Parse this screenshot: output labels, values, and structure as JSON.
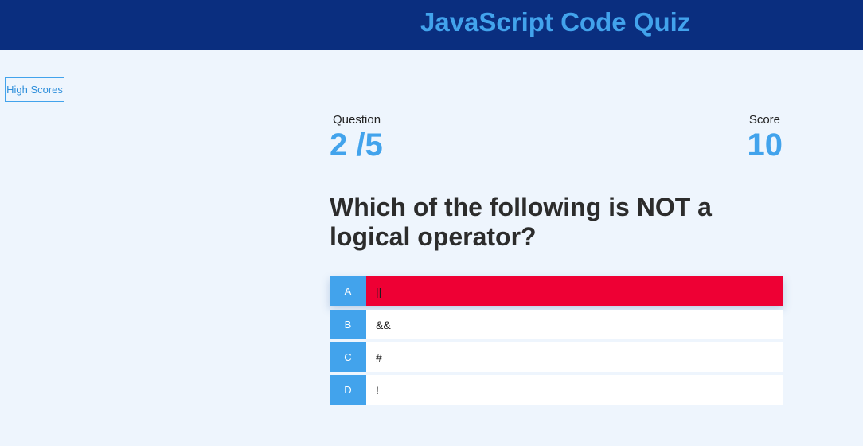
{
  "header": {
    "title": "JavaScript Code Quiz"
  },
  "nav": {
    "high_scores_label": "High Scores"
  },
  "hud": {
    "question_label": "Question",
    "question_progress": "2 /5",
    "score_label": "Score",
    "score_value": "10"
  },
  "question": {
    "text": "Which of the following is NOT a logical operator?",
    "choices": [
      {
        "prefix": "A",
        "text": "||",
        "state": "incorrect"
      },
      {
        "prefix": "B",
        "text": "&&"
      },
      {
        "prefix": "C",
        "text": "#"
      },
      {
        "prefix": "D",
        "text": "!"
      }
    ]
  },
  "colors": {
    "header_bg": "#0a2e7f",
    "accent": "#42a3ec",
    "page_bg": "#eef5fd",
    "incorrect": "#ee0034"
  }
}
